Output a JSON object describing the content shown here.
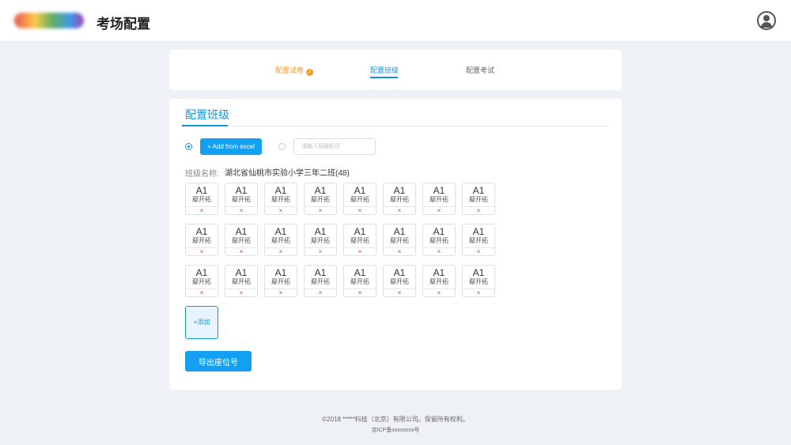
{
  "header": {
    "app_title": "考场配置",
    "user_icon": "user-circle-icon"
  },
  "steps": [
    {
      "label": "配置试卷",
      "status": "done",
      "icon": "check-circle-icon"
    },
    {
      "label": "配置班级",
      "status": "active"
    },
    {
      "label": "配置考试",
      "status": "pending"
    }
  ],
  "section": {
    "title": "配置班级"
  },
  "import": {
    "excel_button_label": "+ Add from excel",
    "class_id_placeholder": "请输入班级标识"
  },
  "class_info": {
    "label": "班级名称:",
    "value": "湖北省仙桃市实验小学三年二班(48)"
  },
  "seats": [
    {
      "code": "A1",
      "name": "鄢开拓"
    },
    {
      "code": "A1",
      "name": "鄢开拓"
    },
    {
      "code": "A1",
      "name": "鄢开拓"
    },
    {
      "code": "A1",
      "name": "鄢开拓"
    },
    {
      "code": "A1",
      "name": "鄢开拓"
    },
    {
      "code": "A1",
      "name": "鄢开拓"
    },
    {
      "code": "A1",
      "name": "鄢开拓"
    },
    {
      "code": "A1",
      "name": "鄢开拓"
    },
    {
      "code": "A1",
      "name": "鄢开拓"
    },
    {
      "code": "A1",
      "name": "鄢开拓"
    },
    {
      "code": "A1",
      "name": "鄢开拓"
    },
    {
      "code": "A1",
      "name": "鄢开拓"
    },
    {
      "code": "A1",
      "name": "鄢开拓"
    },
    {
      "code": "A1",
      "name": "鄢开拓"
    },
    {
      "code": "A1",
      "name": "鄢开拓"
    },
    {
      "code": "A1",
      "name": "鄢开拓"
    },
    {
      "code": "A1",
      "name": "鄢开拓"
    },
    {
      "code": "A1",
      "name": "鄢开拓"
    },
    {
      "code": "A1",
      "name": "鄢开拓"
    },
    {
      "code": "A1",
      "name": "鄢开拓"
    },
    {
      "code": "A1",
      "name": "鄢开拓"
    },
    {
      "code": "A1",
      "name": "鄢开拓"
    },
    {
      "code": "A1",
      "name": "鄢开拓"
    },
    {
      "code": "A1",
      "name": "鄢开拓"
    }
  ],
  "seat_remove_symbol": "×",
  "add_tile_label": "+添加",
  "export_button_label": "导出座位号",
  "footer": {
    "copyright": "©2018 *****科技（北京）有限公司。保留所有权利。",
    "icp": "京ICP备xxxxxxxx号"
  },
  "colors": {
    "primary": "#14a0f0",
    "step_done": "#f59a23",
    "remove": "#e53935",
    "background": "#eef1f6"
  }
}
